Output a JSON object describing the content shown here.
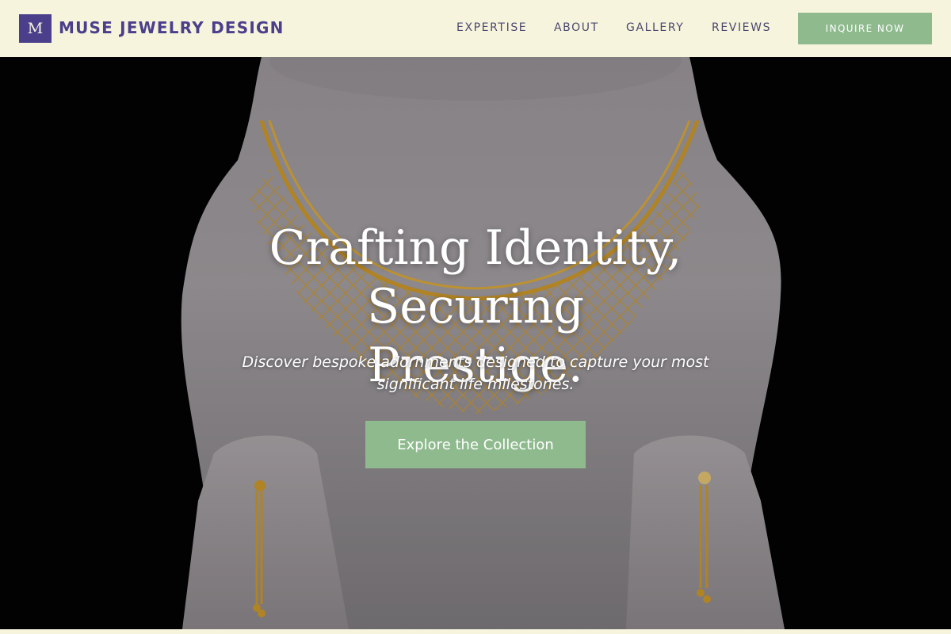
{
  "header": {
    "logo_letter": "M",
    "brand_name": "MUSE JEWELRY DESIGN",
    "nav": [
      {
        "label": "EXPERTISE"
      },
      {
        "label": "ABOUT"
      },
      {
        "label": "GALLERY"
      },
      {
        "label": "REVIEWS"
      }
    ],
    "cta_label": "INQUIRE NOW"
  },
  "hero": {
    "title_line1": "Crafting Identity, Securing",
    "title_line2": "Prestige.",
    "subtitle_line1": "Discover bespoke adornments designed to capture your most",
    "subtitle_line2": "significant life milestones.",
    "button_label": "Explore the Collection"
  },
  "colors": {
    "brand_purple": "#4b3f8c",
    "header_bg": "#f6f4dc",
    "accent_green": "#8fba8e",
    "hero_bg": "#030303",
    "gold": "#c9962a"
  }
}
